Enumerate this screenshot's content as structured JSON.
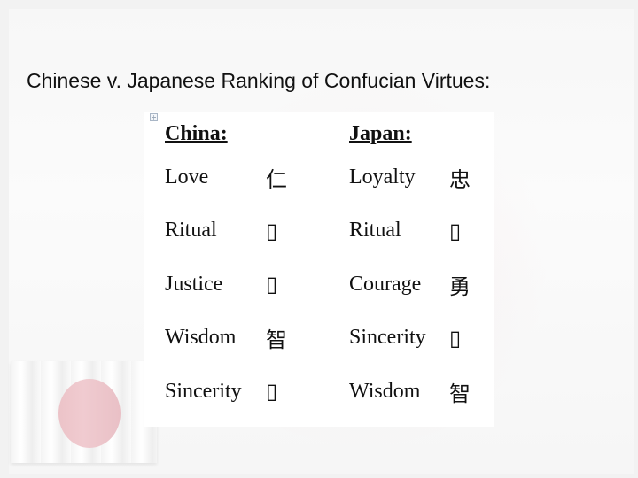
{
  "slide": {
    "title": "Chinese v. Japanese Ranking of Confucian Virtues:",
    "table_anchor_icon": "move-handle-icon",
    "background_image": "japanese-flag",
    "columns": {
      "china_header": "China:",
      "japan_header": "Japan:"
    },
    "rows": [
      {
        "china_en": "Love",
        "china_zh": "仁",
        "japan_en": "Loyalty",
        "japan_zh": "忠"
      },
      {
        "china_en": "Ritual",
        "china_zh": "▯",
        "japan_en": "Ritual",
        "japan_zh": "▯"
      },
      {
        "china_en": "Justice",
        "china_zh": "▯",
        "japan_en": "Courage",
        "japan_zh": "勇"
      },
      {
        "china_en": "Wisdom",
        "china_zh": "智",
        "japan_en": "Sincerity",
        "japan_zh": "▯"
      },
      {
        "china_en": "Sincerity",
        "china_zh": "▯",
        "japan_en": "Wisdom",
        "japan_zh": "智"
      }
    ]
  }
}
